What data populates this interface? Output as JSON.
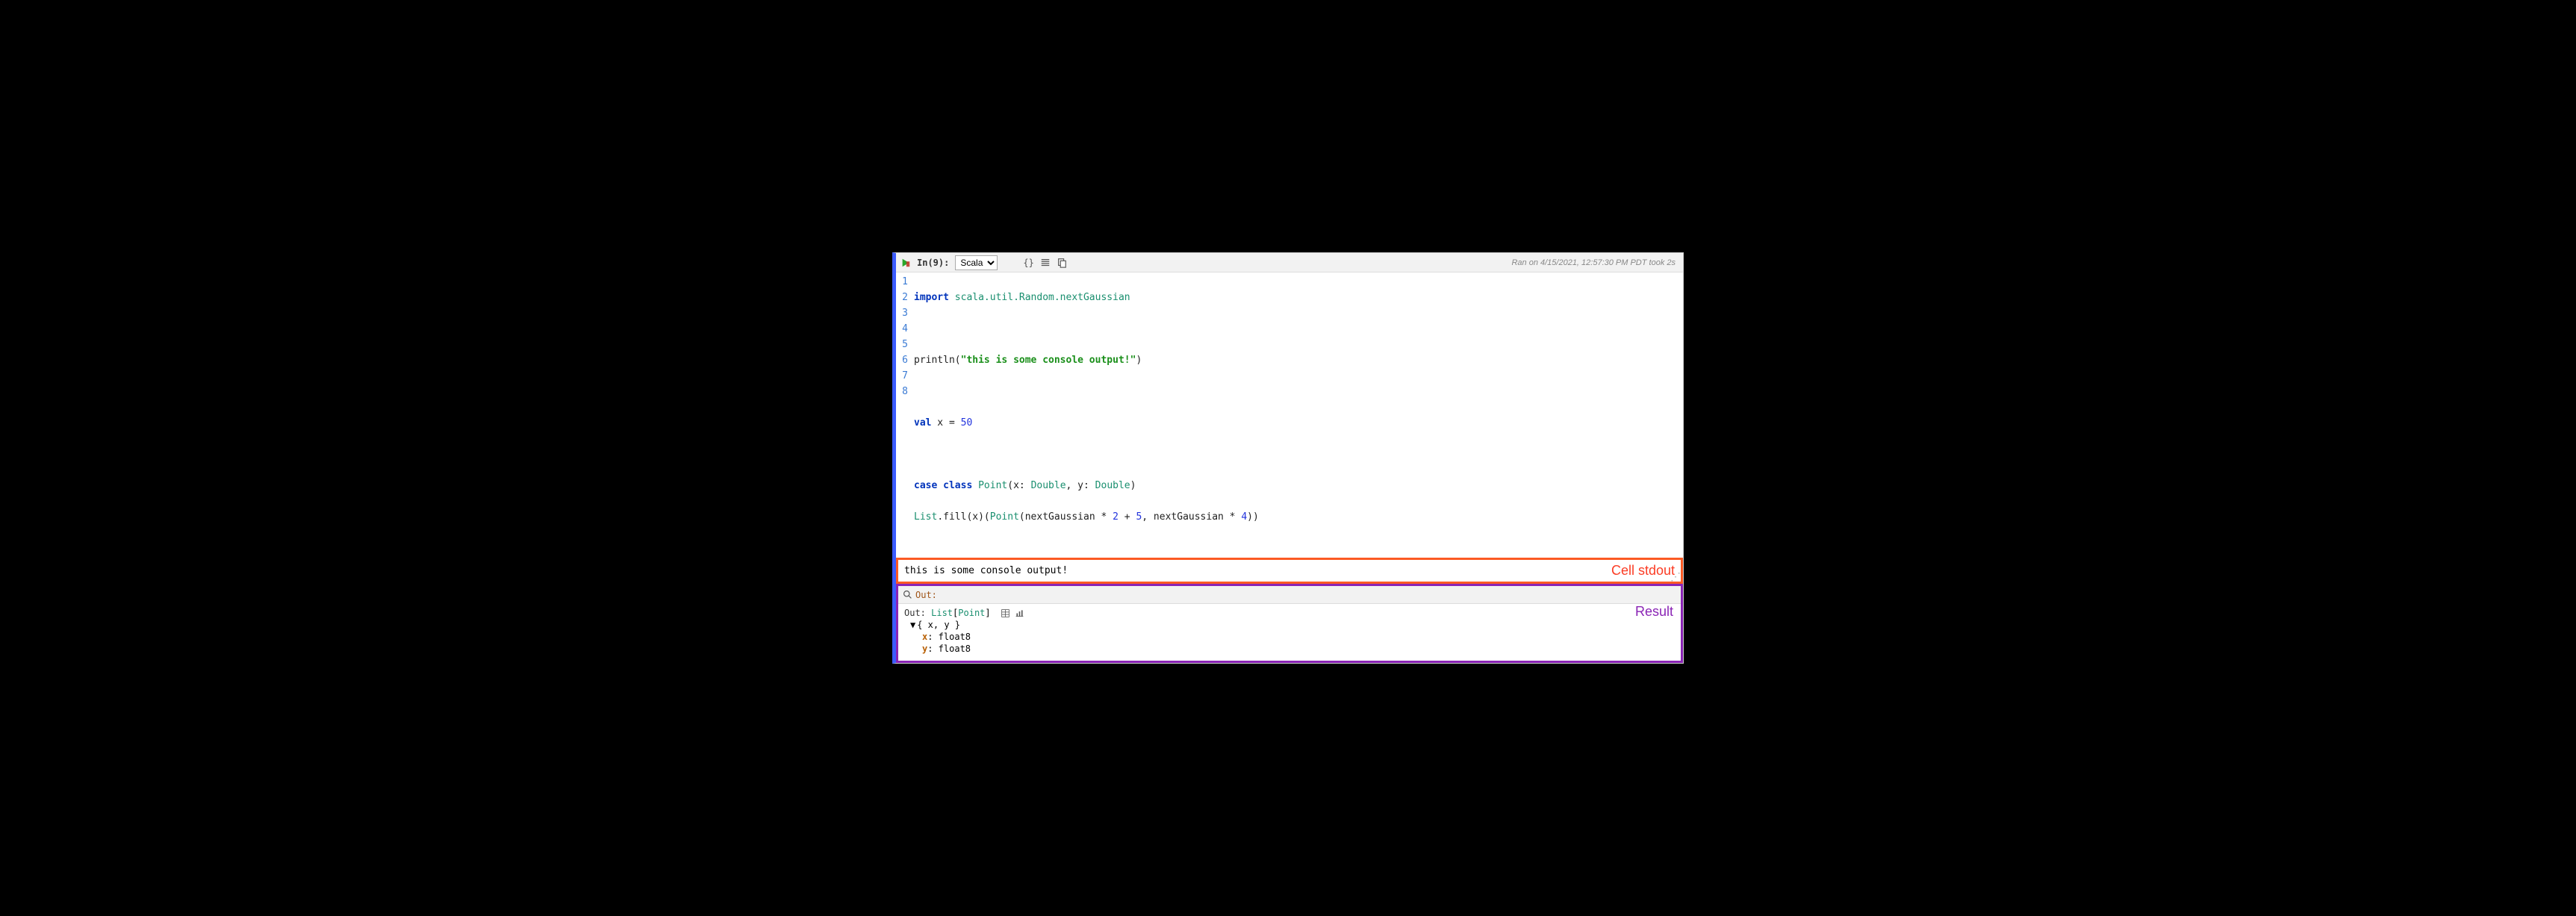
{
  "toolbar": {
    "in_label": "In(9):",
    "language": "Scala",
    "status": "Ran on 4/15/2021, 12:57:30 PM PDT took 2s"
  },
  "code": {
    "lines": [
      "1",
      "2",
      "3",
      "4",
      "5",
      "6",
      "7",
      "8"
    ],
    "l1_kw": "import",
    "l1_path": "scala.util.Random.nextGaussian",
    "l3_call": "println(",
    "l3_str": "\"this is some console output!\"",
    "l3_close": ")",
    "l5_kw": "val",
    "l5_rest_a": " x = ",
    "l5_num": "50",
    "l7_kw1": "case",
    "l7_kw2": "class",
    "l7_name": "Point",
    "l7_sig_a": "(x: ",
    "l7_type1": "Double",
    "l7_sig_b": ", y: ",
    "l7_type2": "Double",
    "l7_sig_c": ")",
    "l8_a": "List",
    "l8_b": ".fill(x)(",
    "l8_c": "Point",
    "l8_d": "(nextGaussian * ",
    "l8_n1": "2",
    "l8_e": " + ",
    "l8_n2": "5",
    "l8_f": ", nextGaussian * ",
    "l8_n3": "4",
    "l8_g": "))"
  },
  "stdout": {
    "text": "this is some console output!",
    "label": "Cell stdout"
  },
  "output": {
    "bar_label": "Out:",
    "result_label": "Result",
    "prefix": "Out: ",
    "type_outer": "List",
    "type_inner": "Point",
    "tree_header": "{ x, y }",
    "field1_key": "x",
    "field1_type": ": float8",
    "field2_key": "y",
    "field2_type": ": float8"
  }
}
